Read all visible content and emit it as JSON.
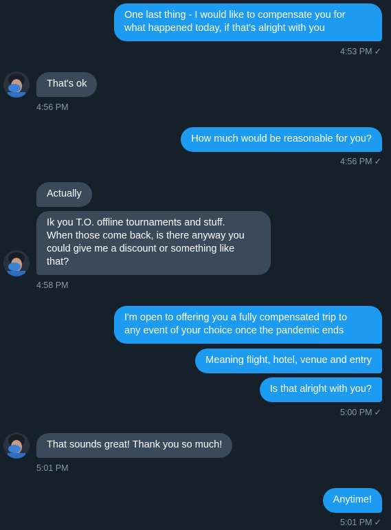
{
  "messages": {
    "m1": {
      "lines": [
        "One last thing - I would like to compensate you for",
        "what happened today, if that's alright with you"
      ],
      "time": "4:53 PM",
      "check": "✓"
    },
    "m2": {
      "text": "That's ok",
      "time": "4:56 PM"
    },
    "m3": {
      "text": "How much would be reasonable for you?",
      "time": "4:56 PM",
      "check": "✓"
    },
    "m4a": {
      "text": "Actually"
    },
    "m4b": {
      "lines": [
        "Ik you T.O. offline tournaments and stuff.",
        "When those come back, is there anyway you",
        "could give me a discount or something like",
        "that?"
      ],
      "time": "4:58 PM"
    },
    "m5a": {
      "lines": [
        "I'm open to offering you a fully compensated trip to",
        "any event of your choice once the pandemic ends"
      ]
    },
    "m5b": {
      "text": "Meaning flight, hotel, venue and entry"
    },
    "m5c": {
      "text": "Is that alright with you?",
      "time": "5:00 PM",
      "check": "✓"
    },
    "m6": {
      "text": "That sounds great! Thank you so much!",
      "time": "5:01 PM"
    },
    "m7": {
      "text": "Anytime!",
      "time": "5:01 PM",
      "check": "✓"
    }
  },
  "colors": {
    "background": "#15202b",
    "outgoing_bubble": "#1d9bf0",
    "incoming_bubble": "#3a4a5a",
    "timestamp": "#8899a6"
  }
}
